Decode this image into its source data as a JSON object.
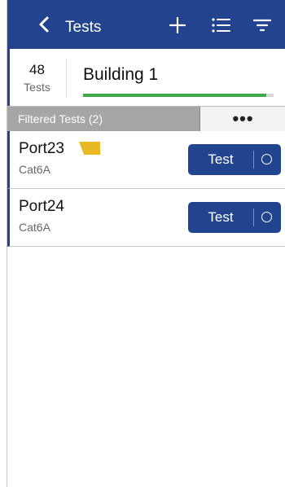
{
  "header": {
    "title": "Tests",
    "back_icon": "chevron-left-icon",
    "add_icon": "plus-icon",
    "list_icon": "list-icon",
    "filter_icon": "filter-icon",
    "bg_color": "#22448f"
  },
  "summary": {
    "count": "48",
    "count_label": "Tests",
    "building": "Building 1",
    "progress_fraction": 0.96,
    "progress_color": "#41a84a"
  },
  "filter": {
    "label": "Filtered Tests (2)",
    "more_label": "•••"
  },
  "tests": [
    {
      "name": "Port23",
      "cable": "Cat6A",
      "tag_color": "#e8b923",
      "button_label": "Test"
    },
    {
      "name": "Port24",
      "cable": "Cat6A",
      "button_label": "Test"
    }
  ]
}
